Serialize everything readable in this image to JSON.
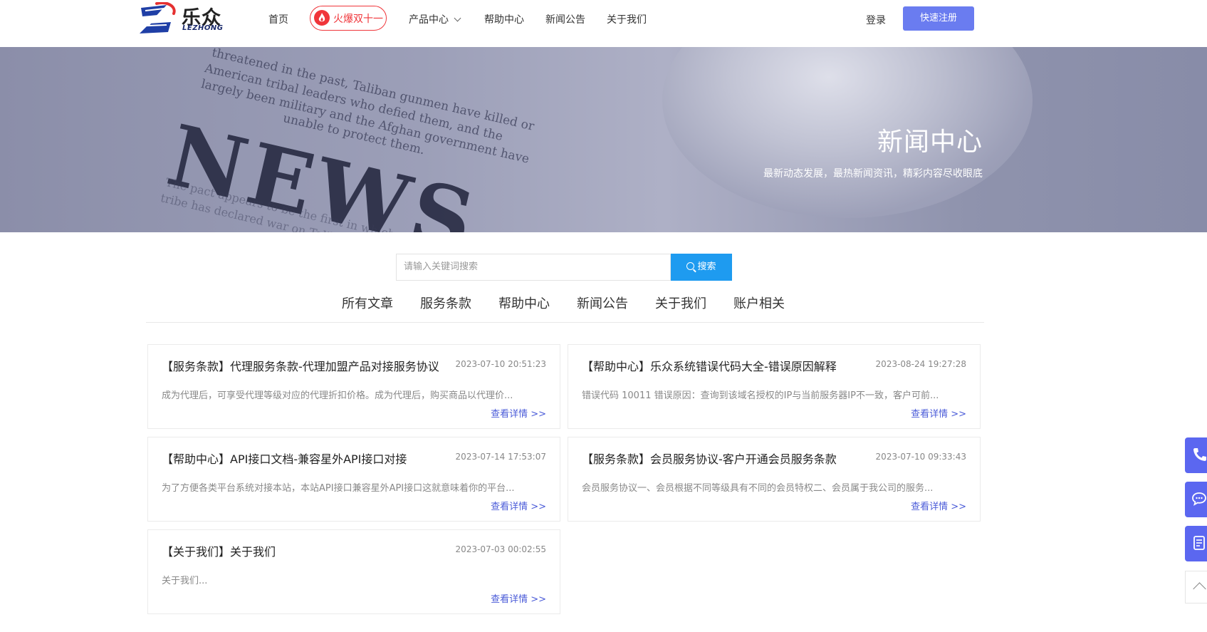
{
  "header": {
    "logo_text": "乐众",
    "logo_sub": "LEZHONG",
    "nav": [
      {
        "label": "首页"
      },
      {
        "label": "火爆双十一"
      },
      {
        "label": "产品中心"
      },
      {
        "label": "帮助中心"
      },
      {
        "label": "新闻公告"
      },
      {
        "label": "关于我们"
      }
    ],
    "login_label": "登录",
    "register_label": "快速注册"
  },
  "banner": {
    "title": "新闻中心",
    "subtitle": "最新动态发展，最热新闻资讯，精彩内容尽收眼底",
    "news_word": "NEWS",
    "paper_lines": [
      "threatened in the past, Taliban gunmen have killed or",
      "American tribal leaders who defied them, and the",
      "largely been military and the Afghan government have",
      "unable to protect them.",
      "The pact appears to be the first in which an entire",
      "tribe has declared war on Taliban"
    ]
  },
  "search": {
    "placeholder": "请输入关键词搜索",
    "button_label": "搜索"
  },
  "categories": [
    "所有文章",
    "服务条款",
    "帮助中心",
    "新闻公告",
    "关于我们",
    "账户相关"
  ],
  "articles": [
    {
      "title": "【服务条款】代理服务条款-代理加盟产品对接服务协议",
      "date": "2023-07-10 20:51:23",
      "excerpt": "成为代理后，可享受代理等级对应的代理折扣价格。成为代理后，购买商品以代理价...",
      "more": "查看详情 >>"
    },
    {
      "title": "【帮助中心】乐众系统错误代码大全-错误原因解释",
      "date": "2023-08-24 19:27:28",
      "excerpt": "错误代码 10011 错误原因：查询到该域名授权的IP与当前服务器IP不一致，客户可前...",
      "more": "查看详情 >>"
    },
    {
      "title": "【帮助中心】API接口文档-兼容星外API接口对接",
      "date": "2023-07-14 17:53:07",
      "excerpt": "为了方便各类平台系统对接本站，本站API接口兼容星外API接口这就意味着你的平台...",
      "more": "查看详情 >>"
    },
    {
      "title": "【服务条款】会员服务协议-客户开通会员服务条款",
      "date": "2023-07-10 09:33:43",
      "excerpt": "会员服务协议一、会员根据不同等级具有不同的会员特权二、会员属于我公司的服务...",
      "more": "查看详情 >>"
    },
    {
      "title": "【关于我们】关于我们",
      "date": "2023-07-03 00:02:55",
      "excerpt": "关于我们...",
      "more": "查看详情 >>"
    }
  ],
  "side_tools": [
    "phone-icon",
    "chat-icon",
    "document-icon",
    "back-to-top-icon"
  ],
  "colors": {
    "accent": "#6a7cf0",
    "hot": "#f0353a",
    "search_btn": "#1e9bf0",
    "link": "#4a5bd8",
    "side": "#5b67f0"
  }
}
